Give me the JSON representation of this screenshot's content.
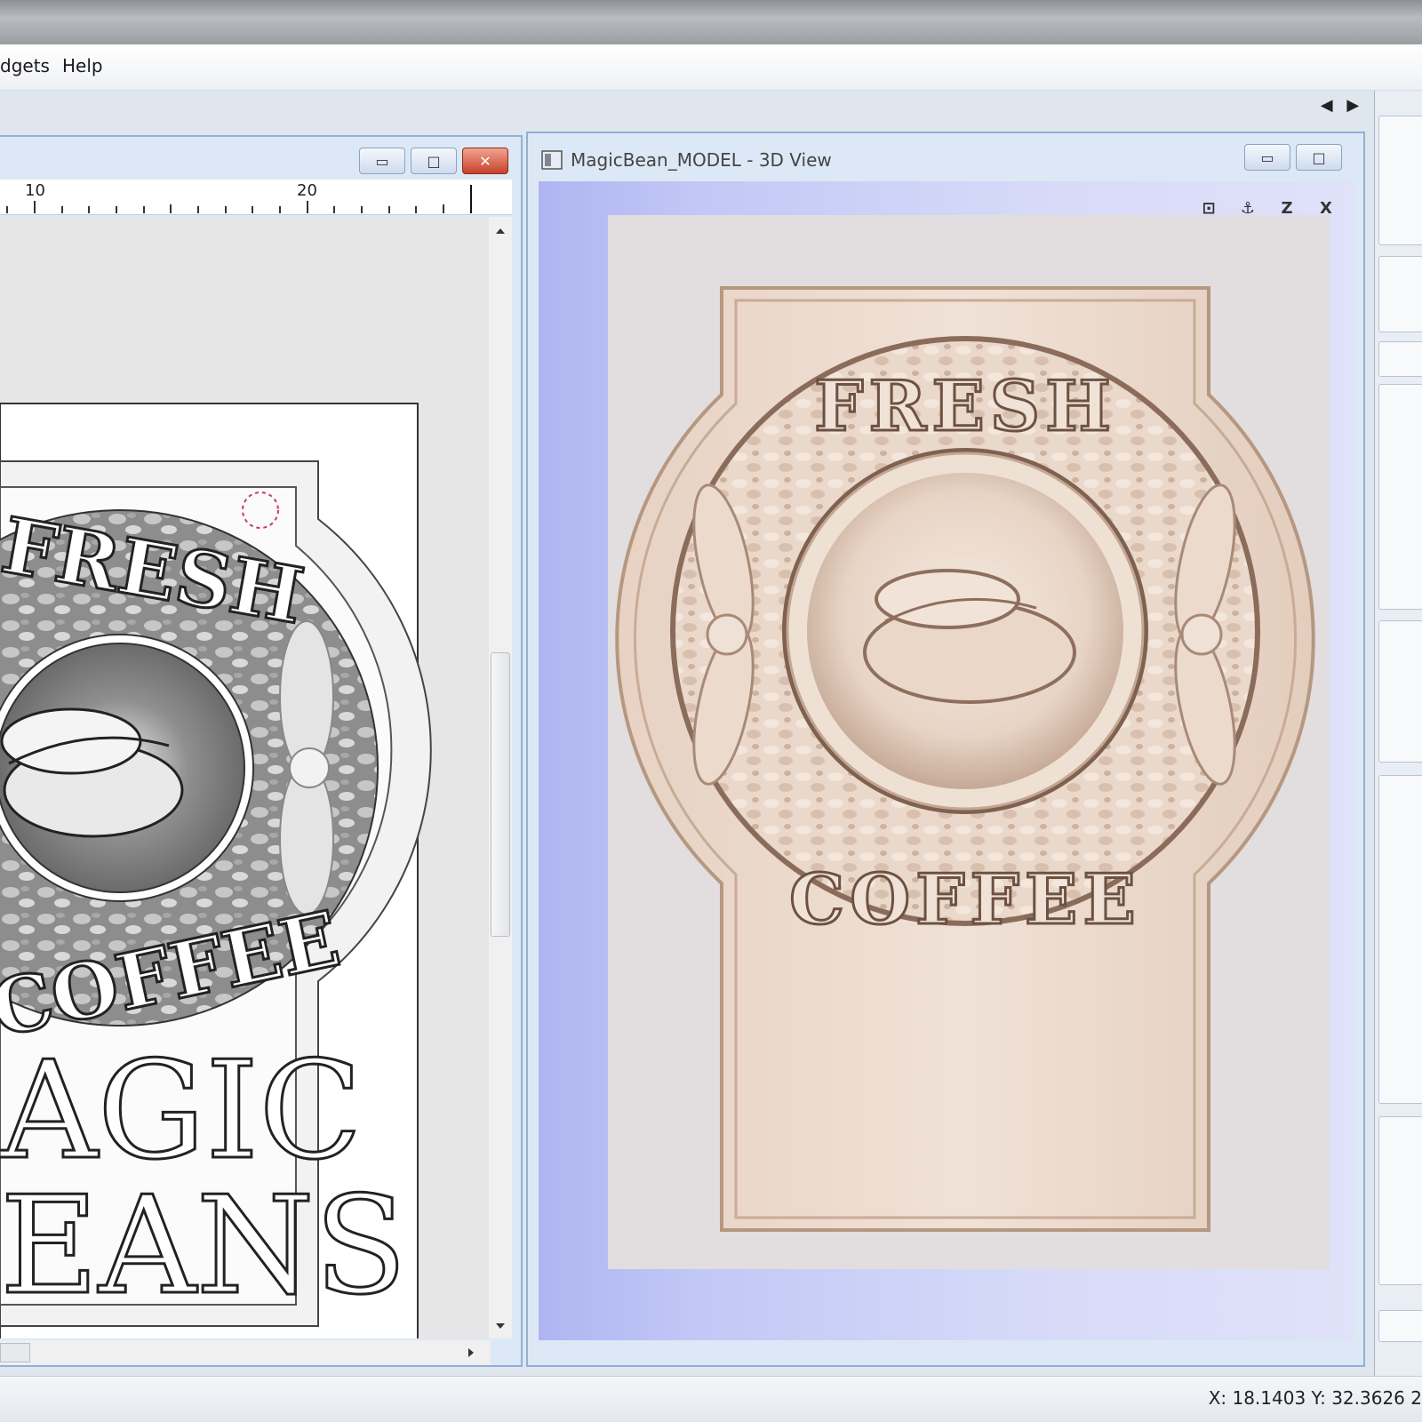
{
  "menu": {
    "items": [
      "dgets",
      "Help"
    ]
  },
  "tabbar": {
    "prev": "◀",
    "next": "▶",
    "close": "✕"
  },
  "view2d": {
    "buttons": {
      "minimize": "▭",
      "maximize": "□",
      "close": "✕"
    },
    "ruler_labels": [
      "10",
      "20"
    ],
    "design_text": {
      "top": "FRESH",
      "bottom": "COFFEE",
      "line1": "AGIC",
      "line2": "EANS"
    }
  },
  "view3d": {
    "title": "MagicBean_MODEL - 3D View",
    "buttons": {
      "minimize": "▭",
      "maximize": "□"
    },
    "icons": [
      "fit-view-icon",
      "anchor-view-icon",
      "view-z-icon",
      "view-x-icon"
    ],
    "icon_labels": {
      "fit": "⊡",
      "anchor": "⚓",
      "z": "Z",
      "x": "X"
    },
    "model_text": {
      "top": "FRESH",
      "bottom": "COFFEE"
    }
  },
  "status": {
    "coords": "X: 18.1403 Y: 32.3626 2"
  },
  "colors": {
    "wood": "#e9d6c7",
    "accent_blue": "#8fb1d8",
    "close_red": "#c8412a"
  }
}
